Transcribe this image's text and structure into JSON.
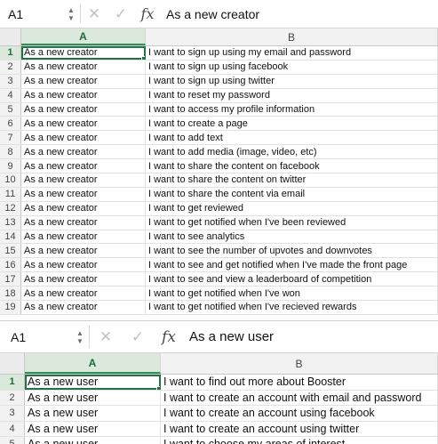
{
  "sheets": [
    {
      "name_box": "A1",
      "formula_value": "As a new creator",
      "columns": [
        "A",
        "B"
      ],
      "rows": [
        {
          "num": "1",
          "a": "As a new creator",
          "b": "I want to sign up using my email and password"
        },
        {
          "num": "2",
          "a": "As a new creator",
          "b": "I want to sign up using facebook"
        },
        {
          "num": "3",
          "a": "As a new creator",
          "b": "I want to sign up using twitter"
        },
        {
          "num": "4",
          "a": "As a new creator",
          "b": "I want to reset my password"
        },
        {
          "num": "5",
          "a": "As a new creator",
          "b": "I want to access my profile information"
        },
        {
          "num": "6",
          "a": "As a new creator",
          "b": "I want to create a page"
        },
        {
          "num": "7",
          "a": "As a new creator",
          "b": "I want to add text"
        },
        {
          "num": "8",
          "a": "As a new creator",
          "b": "I want to add media (image, video, etc)"
        },
        {
          "num": "9",
          "a": "As a new creator",
          "b": "I want to share the content on facebook"
        },
        {
          "num": "10",
          "a": "As a new creator",
          "b": "I want to share the content on twitter"
        },
        {
          "num": "11",
          "a": "As a new creator",
          "b": "I want to share the content via email"
        },
        {
          "num": "12",
          "a": "As a new creator",
          "b": "I want to get reviewed"
        },
        {
          "num": "13",
          "a": "As a new creator",
          "b": "I want to get notified when I've been reviewed"
        },
        {
          "num": "14",
          "a": "As a new creator",
          "b": "I want to see analytics"
        },
        {
          "num": "15",
          "a": "As a new creator",
          "b": "I want to see the number of upvotes and downvotes"
        },
        {
          "num": "16",
          "a": "As a new creator",
          "b": "I want to see and get notified when I've made the front page"
        },
        {
          "num": "17",
          "a": "As a new creator",
          "b": "I want to see and view a leaderboard of competition"
        },
        {
          "num": "18",
          "a": "As a new creator",
          "b": "I want to get notified when I've won"
        },
        {
          "num": "19",
          "a": "As a new creator",
          "b": "I want to get notified when I've recieved rewards"
        }
      ]
    },
    {
      "name_box": "A1",
      "formula_value": "As a new user",
      "columns": [
        "A",
        "B"
      ],
      "rows": [
        {
          "num": "1",
          "a": "As a new user",
          "b": "I want to find out more about Booster"
        },
        {
          "num": "2",
          "a": "As a new user",
          "b": "I want to create an account with email and password"
        },
        {
          "num": "3",
          "a": "As a new user",
          "b": "I want to create an account using facebook"
        },
        {
          "num": "4",
          "a": "As a new user",
          "b": "I want to create an account using twitter"
        },
        {
          "num": "5",
          "a": "As a new user",
          "b": "I want to choose my areas of interest"
        }
      ]
    }
  ],
  "icons": {
    "cancel": "✕",
    "confirm": "✓",
    "function": "fx",
    "stepper_up": "▲",
    "stepper_down": "▼"
  },
  "colors": {
    "selection": "#217346",
    "active_header": "#dbe8dc"
  }
}
